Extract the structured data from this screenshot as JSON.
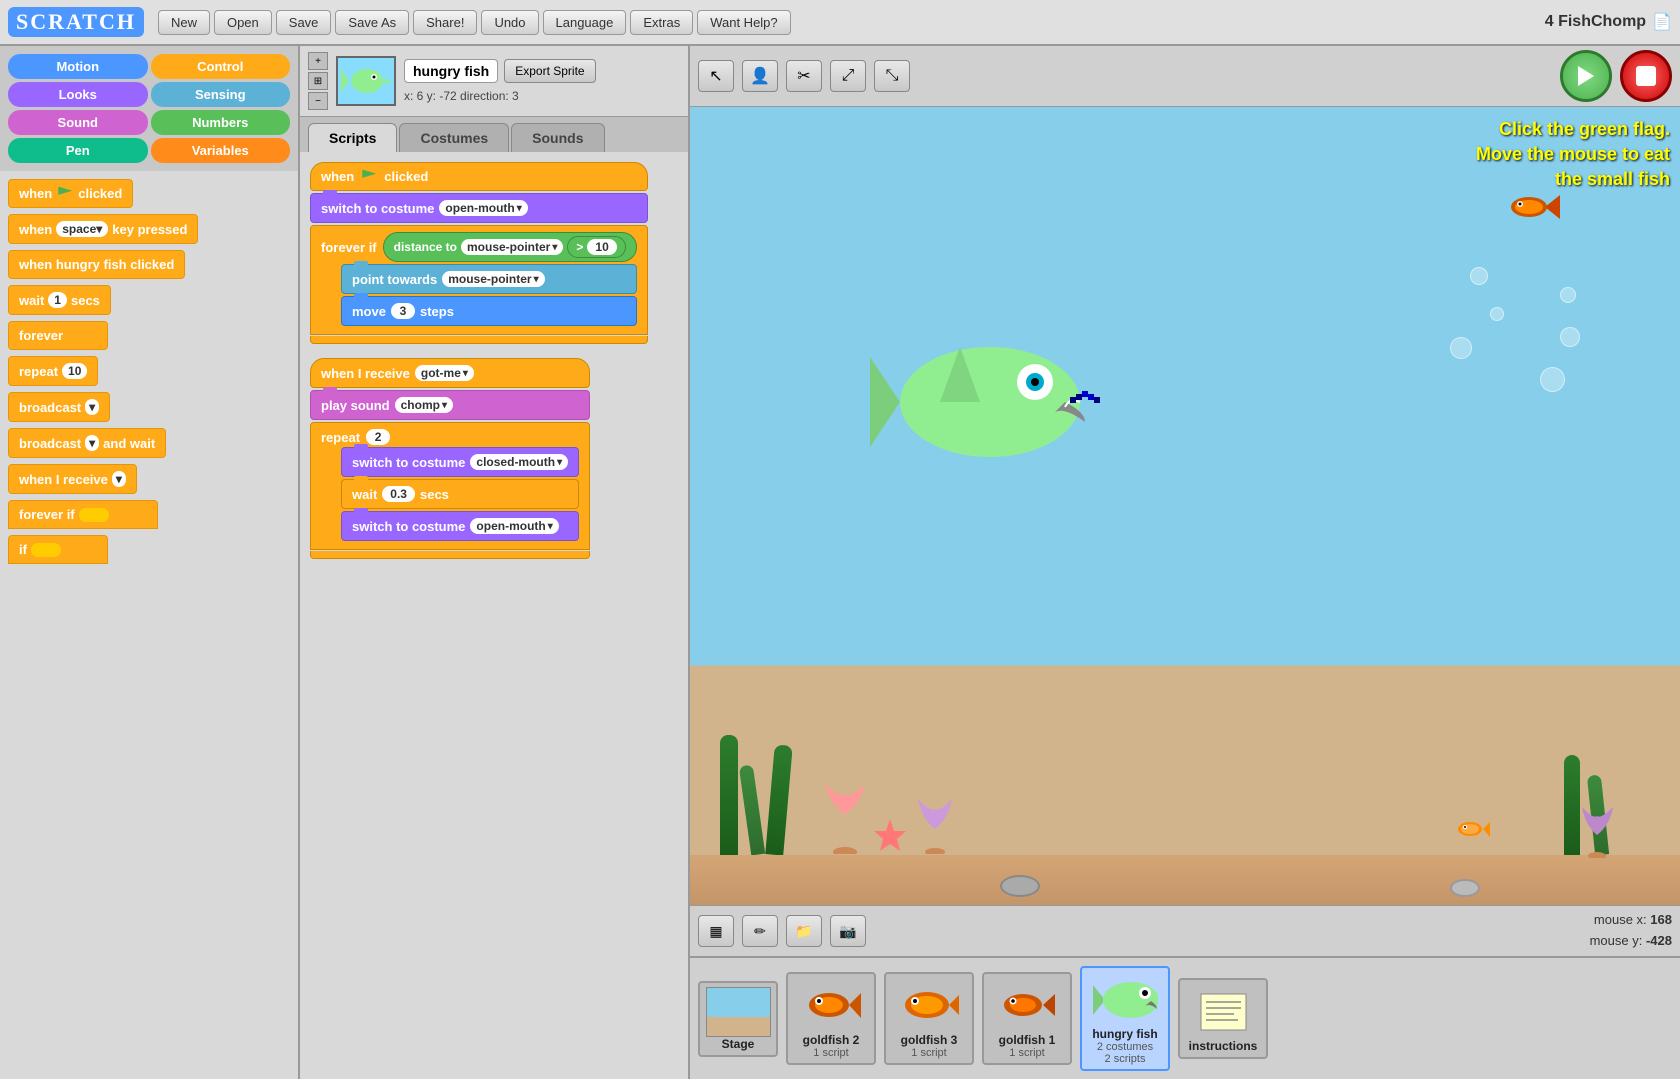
{
  "topbar": {
    "logo": "SCRATCH",
    "buttons": [
      "New",
      "Open",
      "Save",
      "Save As",
      "Share!",
      "Undo",
      "Language",
      "Extras",
      "Want Help?"
    ],
    "project_name": "4 FishChomp"
  },
  "left_panel": {
    "categories": [
      {
        "label": "Motion",
        "class": "cat-motion"
      },
      {
        "label": "Control",
        "class": "cat-control"
      },
      {
        "label": "Looks",
        "class": "cat-looks"
      },
      {
        "label": "Sensing",
        "class": "cat-sensing"
      },
      {
        "label": "Sound",
        "class": "cat-sound"
      },
      {
        "label": "Numbers",
        "class": "cat-numbers"
      },
      {
        "label": "Pen",
        "class": "cat-pen"
      },
      {
        "label": "Variables",
        "class": "cat-variables"
      }
    ],
    "blocks": [
      {
        "label": "when  clicked",
        "type": "orange",
        "icon": "flag"
      },
      {
        "label": "when  space  key pressed",
        "type": "orange"
      },
      {
        "label": "when hungry fish clicked",
        "type": "orange"
      },
      {
        "label": "wait  1  secs",
        "type": "orange"
      },
      {
        "label": "forever",
        "type": "orange"
      },
      {
        "label": "repeat  10",
        "type": "orange"
      },
      {
        "label": "broadcast ",
        "type": "orange"
      },
      {
        "label": "broadcast  and wait",
        "type": "orange"
      },
      {
        "label": "when I receive ",
        "type": "orange"
      },
      {
        "label": "forever if ",
        "type": "orange"
      },
      {
        "label": "if ",
        "type": "orange"
      }
    ]
  },
  "sprite_header": {
    "name": "hungry fish",
    "x": "6",
    "y": "-72",
    "direction": "3",
    "coords_label": "x: 6   y: -72   direction: 3",
    "export_btn": "Export Sprite"
  },
  "tabs": [
    "Scripts",
    "Costumes",
    "Sounds"
  ],
  "scripts": {
    "script1": {
      "hat": "when  clicked",
      "blocks": [
        {
          "type": "purple",
          "text": "switch to costume",
          "dropdown": "open-mouth"
        },
        {
          "type": "forever-if",
          "condition": "distance to  mouse-pointer  >  10",
          "inner": [
            {
              "type": "teal",
              "text": "point towards",
              "dropdown": "mouse-pointer"
            },
            {
              "type": "blue",
              "text": "move",
              "input": "3",
              "suffix": "steps"
            }
          ]
        }
      ]
    },
    "script2": {
      "hat": "when I receive",
      "hat_dropdown": "got-me",
      "blocks": [
        {
          "type": "sound",
          "text": "play sound",
          "dropdown": "chomp"
        },
        {
          "type": "repeat",
          "input": "2",
          "inner": [
            {
              "type": "purple",
              "text": "switch to costume",
              "dropdown": "closed-mouth"
            },
            {
              "type": "orange",
              "text": "wait",
              "input": "0.3",
              "suffix": "secs"
            },
            {
              "type": "purple",
              "text": "switch to costume",
              "dropdown": "open-mouth"
            }
          ]
        }
      ]
    }
  },
  "stage": {
    "instruction_text": "Click the green flag.\nMove the mouse to eat\nthe small fish",
    "mouse_x_label": "mouse x:",
    "mouse_x_value": "168",
    "mouse_y_label": "mouse y:",
    "mouse_y_value": "-428"
  },
  "sprites": [
    {
      "name": "Stage",
      "type": "stage",
      "info": ""
    },
    {
      "name": "goldfish 2",
      "info": "1 script"
    },
    {
      "name": "goldfish 3",
      "info": "1 script"
    },
    {
      "name": "goldfish 1",
      "info": "1 script"
    },
    {
      "name": "hungry fish",
      "info": "2 costumes\n2 scripts",
      "active": true
    },
    {
      "name": "instructions",
      "info": ""
    }
  ]
}
